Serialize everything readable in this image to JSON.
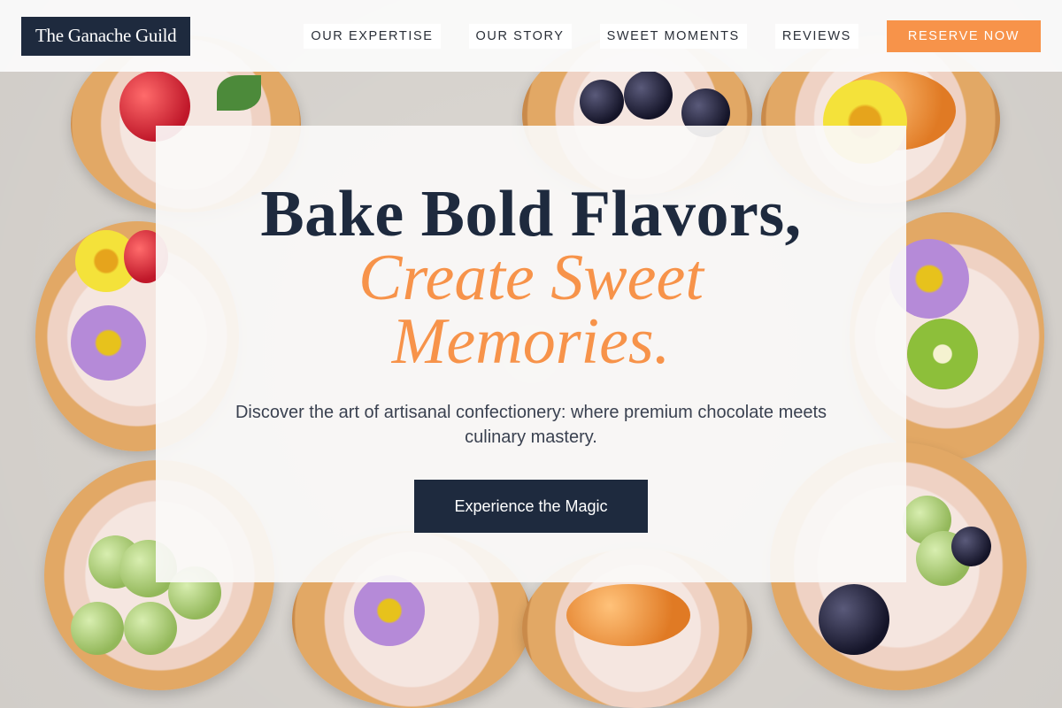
{
  "header": {
    "logo_text": "The Ganache Guild",
    "nav": [
      {
        "label": "OUR EXPERTISE"
      },
      {
        "label": "OUR STORY"
      },
      {
        "label": "SWEET MOMENTS"
      },
      {
        "label": "REVIEWS"
      }
    ],
    "cta_label": "RESERVE NOW"
  },
  "hero": {
    "title": "Bake Bold Flavors,",
    "accent_title": "Create Sweet Memories.",
    "subtitle": "Discover the art of artisanal confectionery: where premium chocolate meets culinary mastery.",
    "button_label": "Experience the Magic"
  },
  "colors": {
    "navy": "#1e2a3e",
    "accent_orange": "#f7934a",
    "card_background": "#faf9f8"
  }
}
